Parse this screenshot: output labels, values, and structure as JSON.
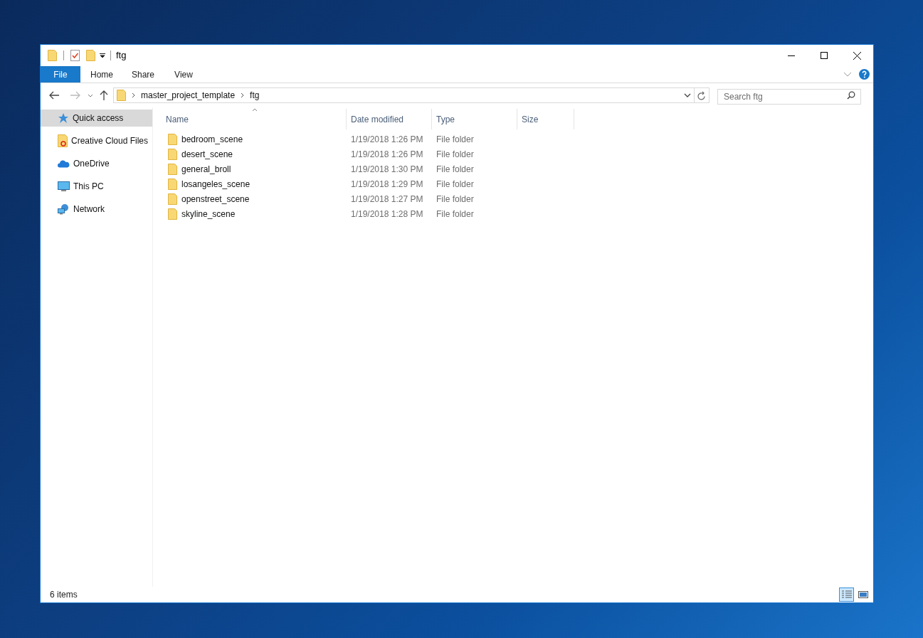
{
  "window": {
    "title": "ftg"
  },
  "ribbon_tabs": [
    {
      "label": "File",
      "selected": true
    },
    {
      "label": "Home",
      "selected": false
    },
    {
      "label": "Share",
      "selected": false
    },
    {
      "label": "View",
      "selected": false
    }
  ],
  "breadcrumb": [
    "master_project_template",
    "ftg"
  ],
  "search": {
    "placeholder": "Search ftg"
  },
  "sidebar": {
    "items": [
      {
        "label": "Quick access",
        "kind": "star",
        "selected": true
      },
      {
        "label": "Creative Cloud Files",
        "kind": "cloudfiles",
        "selected": false
      },
      {
        "label": "OneDrive",
        "kind": "onedrive",
        "selected": false
      },
      {
        "label": "This PC",
        "kind": "pc",
        "selected": false
      },
      {
        "label": "Network",
        "kind": "network",
        "selected": false
      }
    ]
  },
  "table": {
    "columns": [
      "Name",
      "Date modified",
      "Type",
      "Size"
    ],
    "rows": [
      {
        "name": "bedroom_scene",
        "date": "1/19/2018 1:26 PM",
        "type": "File folder"
      },
      {
        "name": "desert_scene",
        "date": "1/19/2018 1:26 PM",
        "type": "File folder"
      },
      {
        "name": "general_broll",
        "date": "1/19/2018 1:30 PM",
        "type": "File folder"
      },
      {
        "name": "losangeles_scene",
        "date": "1/19/2018 1:29 PM",
        "type": "File folder"
      },
      {
        "name": "openstreet_scene",
        "date": "1/19/2018 1:27 PM",
        "type": "File folder"
      },
      {
        "name": "skyline_scene",
        "date": "1/19/2018 1:28 PM",
        "type": "File folder"
      }
    ]
  },
  "status_bar": {
    "count": "6 items",
    "views": [
      {
        "kind": "details",
        "selected": true
      },
      {
        "kind": "large",
        "selected": false
      }
    ]
  }
}
